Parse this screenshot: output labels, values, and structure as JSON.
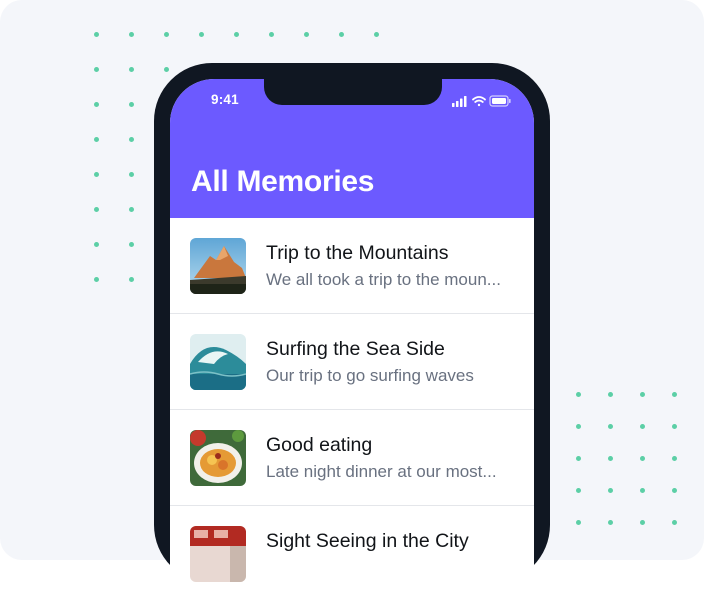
{
  "status_bar": {
    "time": "9:41"
  },
  "header": {
    "title": "All Memories"
  },
  "memories": [
    {
      "title": "Trip to the Mountains",
      "subtitle": "We all took a trip to the moun...",
      "image": "mountain-photo"
    },
    {
      "title": "Surfing the Sea Side",
      "subtitle": "Our trip to go surfing waves",
      "image": "wave-photo"
    },
    {
      "title": "Good eating",
      "subtitle": "Late night dinner at our most...",
      "image": "food-photo"
    },
    {
      "title": "Sight Seeing in the City",
      "subtitle": "",
      "image": "city-photo"
    }
  ],
  "colors": {
    "accent": "#6c5aff",
    "phone_frame": "#101722",
    "dots": "#5ccfa6",
    "background": "#f4f6fa"
  }
}
